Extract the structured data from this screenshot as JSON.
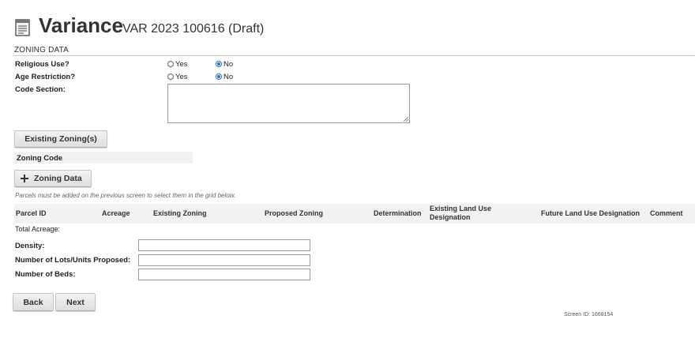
{
  "header": {
    "title": "Variance",
    "subtitle": "VAR 2023 100616 (Draft)",
    "icon": "document-icon"
  },
  "section": {
    "title": "ZONING DATA"
  },
  "religious_use": {
    "label": "Religious Use?",
    "options": [
      "Yes",
      "No"
    ],
    "selected": "No"
  },
  "age_restriction": {
    "label": "Age Restriction?",
    "options": [
      "Yes",
      "No"
    ],
    "selected": "No"
  },
  "code_section": {
    "label": "Code Section:",
    "value": ""
  },
  "existing_zoning": {
    "button_label": "Existing Zoning(s)",
    "column_header": "Zoning Code"
  },
  "zoning_data": {
    "add_button_label": "Zoning Data",
    "hint": "Parcels must be added on the previous screen to select them in the grid below.",
    "columns": [
      "Parcel ID",
      "Acreage",
      "Existing Zoning",
      "Proposed Zoning",
      "Determination",
      "Existing Land Use Designation",
      "Future Land Use Designation",
      "Comment"
    ],
    "total_acreage_label": "Total Acreage:"
  },
  "fields": {
    "density_label": "Density:",
    "density_value": "",
    "lots_label": "Number of Lots/Units Proposed:",
    "lots_value": "",
    "beds_label": "Number of Beds:",
    "beds_value": ""
  },
  "nav": {
    "back_label": "Back",
    "next_label": "Next"
  },
  "footer": {
    "screen_id": "Screen ID: 1668154"
  },
  "colors": {
    "radio_selected": "#2a6fd1",
    "grid_header_bg": "#f2f2f2"
  }
}
